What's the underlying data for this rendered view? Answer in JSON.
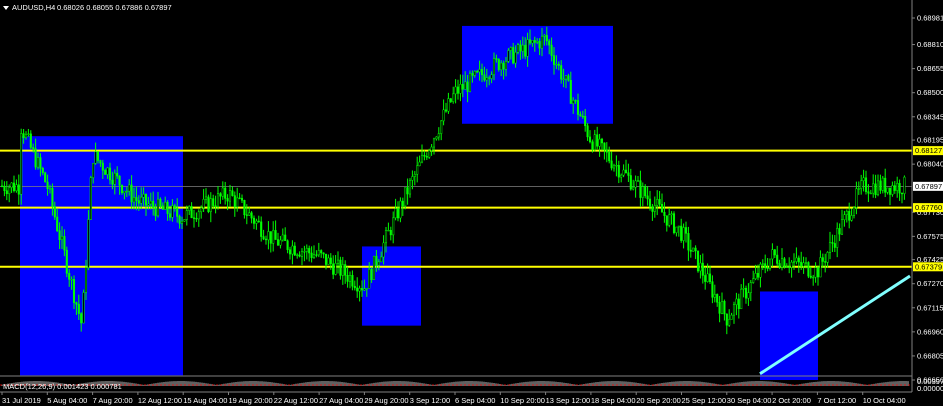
{
  "window": {
    "symbol_title": "AUDUSD,H4",
    "ohlc_text": "0.68026 0.68055 0.67886 0.67897",
    "dropdown_icon": "triangle-down-icon"
  },
  "indicator": {
    "label": "MACD(12,26,9) 0.001423 0.000781",
    "right_values": [
      "0.003978",
      "0.000000"
    ]
  },
  "price_axis": {
    "labels": [
      "0.68981",
      "0.68810",
      "0.68655",
      "0.68500",
      "0.68345",
      "0.68195",
      "0.68040",
      "0.67730",
      "0.67575",
      "0.67425",
      "0.67270",
      "0.67115",
      "0.66960",
      "0.66805",
      "0.66650"
    ]
  },
  "time_axis": {
    "labels": [
      "31 Jul 2019",
      "5 Aug 04:00",
      "7 Aug 20:00",
      "12 Aug 12:00",
      "15 Aug 04:00",
      "19 Aug 20:00",
      "22 Aug 12:00",
      "27 Aug 04:00",
      "29 Aug 20:00",
      "3 Sep 12:00",
      "6 Sep 04:00",
      "10 Sep 20:00",
      "13 Sep 12:00",
      "18 Sep 04:00",
      "20 Sep 20:00",
      "25 Sep 12:00",
      "30 Sep 04:00",
      "2 Oct 20:00",
      "7 Oct 12:00",
      "10 Oct 04:00"
    ]
  },
  "levels": {
    "current_price": "0.67897",
    "resistance_1": "0.68127",
    "support_1": "0.67760",
    "support_2": "0.67379"
  },
  "colors": {
    "background": "#000000",
    "candles": "#00ff00",
    "zone": "#0000ff",
    "level_line": "#ffff00",
    "trendline": "#80ffff",
    "axis_text": "#ffffff",
    "macd_hist": "#c0c0c0",
    "macd_signal": "#ff0000"
  },
  "chart_data": {
    "type": "candlestick",
    "symbol": "AUDUSD",
    "timeframe": "H4",
    "last_bar": {
      "open": 0.68026,
      "high": 0.68055,
      "low": 0.67886,
      "close": 0.67897
    },
    "price_anchors": [
      {
        "x": "31 Jul 2019",
        "price": 0.6895
      },
      {
        "x": "1 Aug 2019",
        "price": 0.683
      },
      {
        "x": "5 Aug 04:00",
        "price": 0.679
      },
      {
        "x": "6 Aug 2019",
        "price": 0.67
      },
      {
        "x": "7 Aug 20:00",
        "price": 0.681
      },
      {
        "x": "12 Aug 12:00",
        "price": 0.678
      },
      {
        "x": "15 Aug 04:00",
        "price": 0.677
      },
      {
        "x": "19 Aug 20:00",
        "price": 0.6785
      },
      {
        "x": "22 Aug 12:00",
        "price": 0.6755
      },
      {
        "x": "27 Aug 04:00",
        "price": 0.6745
      },
      {
        "x": "29 Aug 20:00",
        "price": 0.6725
      },
      {
        "x": "3 Sep 12:00",
        "price": 0.679
      },
      {
        "x": "6 Sep 04:00",
        "price": 0.685
      },
      {
        "x": "10 Sep 20:00",
        "price": 0.687
      },
      {
        "x": "13 Sep 12:00",
        "price": 0.6885
      },
      {
        "x": "18 Sep 04:00",
        "price": 0.682
      },
      {
        "x": "20 Sep 20:00",
        "price": 0.679
      },
      {
        "x": "25 Sep 12:00",
        "price": 0.676
      },
      {
        "x": "30 Sep 04:00",
        "price": 0.6705
      },
      {
        "x": "2 Oct 20:00",
        "price": 0.6745
      },
      {
        "x": "7 Oct 12:00",
        "price": 0.6735
      },
      {
        "x": "10 Oct 04:00",
        "price": 0.679
      }
    ],
    "horizontal_levels": [
      0.68127,
      0.6776,
      0.67379
    ],
    "highlight_zones": [
      {
        "from": "31 Jul 2019",
        "to": "14 Aug 2019",
        "price_low": 0.6668,
        "price_high": 0.6822
      },
      {
        "from": "28 Aug 2019",
        "to": "3 Sep 2019",
        "price_low": 0.67,
        "price_high": 0.6751
      },
      {
        "from": "5 Sep 2019",
        "to": "17 Sep 2019",
        "price_low": 0.683,
        "price_high": 0.6893
      },
      {
        "from": "1 Oct 2019",
        "to": "4 Oct 2019",
        "price_low": 0.6665,
        "price_high": 0.6722
      }
    ],
    "trendline": {
      "from": {
        "x": "1 Oct 2019",
        "price": 0.6669
      },
      "to": {
        "x": "11 Oct 2019",
        "price": 0.6732
      }
    },
    "price_range": [
      0.6665,
      0.68981
    ]
  }
}
